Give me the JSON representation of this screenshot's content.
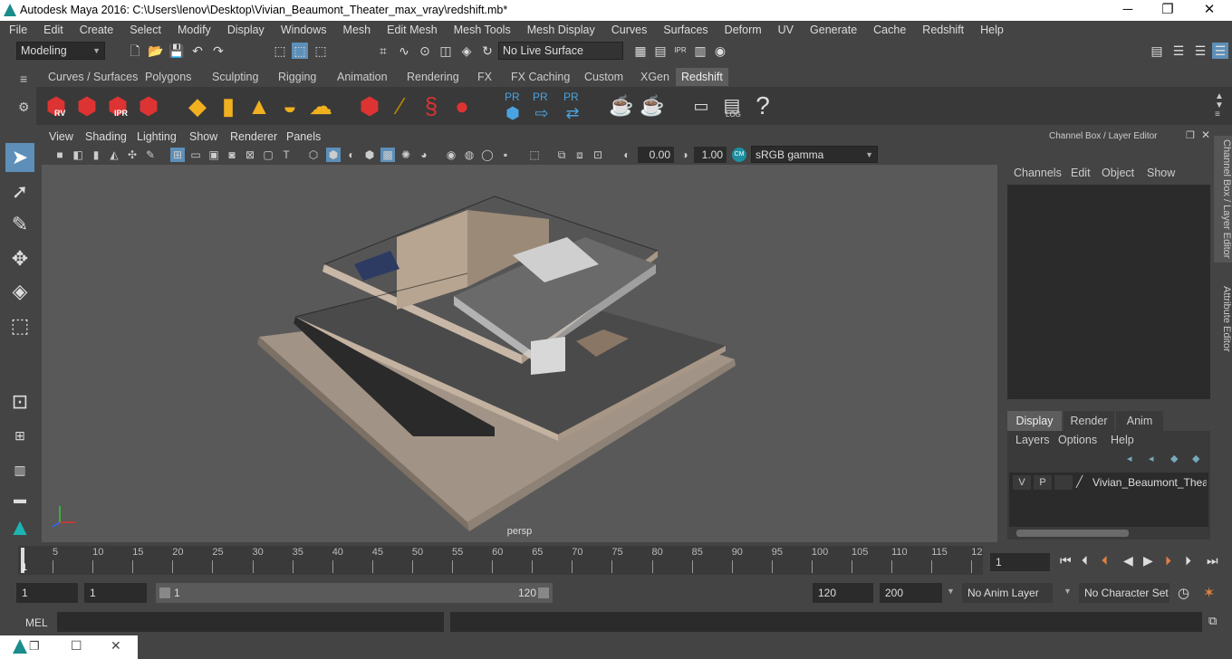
{
  "window": {
    "title": "Autodesk Maya 2016: C:\\Users\\lenov\\Desktop\\Vivian_Beaumont_Theater_max_vray\\redshift.mb*",
    "minimize": "─",
    "maximize": "❐",
    "close": "✕"
  },
  "menubar": [
    "File",
    "Edit",
    "Create",
    "Select",
    "Modify",
    "Display",
    "Windows",
    "Mesh",
    "Edit Mesh",
    "Mesh Tools",
    "Mesh Display",
    "Curves",
    "Surfaces",
    "Deform",
    "UV",
    "Generate",
    "Cache",
    "Redshift",
    "Help"
  ],
  "statusline": {
    "mode": "Modeling",
    "live_surface": "No Live Surface"
  },
  "shelf_tabs": [
    "Curves / Surfaces",
    "Polygons",
    "Sculpting",
    "Rigging",
    "Animation",
    "Rendering",
    "FX",
    "FX Caching",
    "Custom",
    "XGen",
    "Redshift"
  ],
  "active_shelf": "Redshift",
  "shelf_labels": {
    "rv": "RV",
    "ipr": "IPR",
    "pr": "PR",
    "log": "LOG",
    "help": "?"
  },
  "viewport_menu": [
    "View",
    "Shading",
    "Lighting",
    "Show",
    "Renderer",
    "Panels"
  ],
  "viewport_toolbar": {
    "exposure": "0.00",
    "gamma": "1.00",
    "colorspace": "sRGB gamma",
    "cm_badge": "CM"
  },
  "camera": "persp",
  "channel_box": {
    "title": "Channel Box / Layer Editor",
    "menus": [
      "Channels",
      "Edit",
      "Object",
      "Show"
    ]
  },
  "layer_editor": {
    "tabs": [
      "Display",
      "Render",
      "Anim"
    ],
    "active_tab": "Display",
    "menus": [
      "Layers",
      "Options",
      "Help"
    ],
    "layer": {
      "v": "V",
      "p": "P",
      "name": "Vivian_Beaumont_Theater"
    }
  },
  "side_tabs": [
    "Channel Box / Layer Editor",
    "Attribute Editor"
  ],
  "timeline": {
    "ticks": [
      "5",
      "10",
      "15",
      "20",
      "25",
      "30",
      "35",
      "40",
      "45",
      "50",
      "55",
      "60",
      "65",
      "70",
      "75",
      "80",
      "85",
      "90",
      "95",
      "100",
      "105",
      "110",
      "115",
      "12"
    ],
    "start_marker": "1",
    "current_frame": "1"
  },
  "range": {
    "start": "1",
    "anim_start": "1",
    "slider_start": "1",
    "slider_end": "120",
    "end": "120",
    "anim_end": "200",
    "anim_layer": "No Anim Layer",
    "char_set": "No Character Set"
  },
  "command": {
    "label": "MEL"
  },
  "colors": {
    "accent": "#5d8fb8",
    "panel": "#444444",
    "field": "#2b2b2b",
    "viewport": "#595959"
  }
}
